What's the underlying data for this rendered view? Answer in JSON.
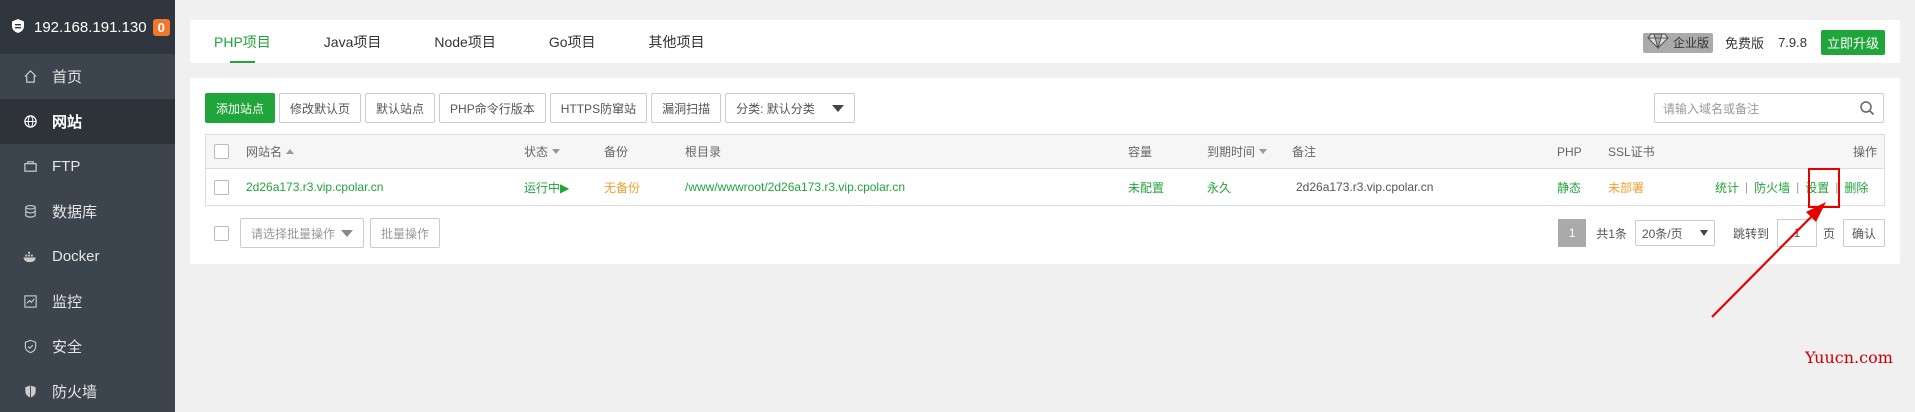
{
  "sidebar": {
    "ip": "192.168.191.130",
    "badge": "0",
    "items": [
      {
        "label": "首页",
        "icon": "home-icon"
      },
      {
        "label": "网站",
        "icon": "globe-icon",
        "active": true
      },
      {
        "label": "FTP",
        "icon": "ftp-icon"
      },
      {
        "label": "数据库",
        "icon": "database-icon"
      },
      {
        "label": "Docker",
        "icon": "docker-icon"
      },
      {
        "label": "监控",
        "icon": "monitor-icon"
      },
      {
        "label": "安全",
        "icon": "shield-icon"
      },
      {
        "label": "防火墙",
        "icon": "firewall-icon"
      }
    ]
  },
  "tabs": [
    "PHP项目",
    "Java项目",
    "Node项目",
    "Go项目",
    "其他项目"
  ],
  "header_right": {
    "enterprise": "企业版",
    "free": "免费版",
    "version": "7.9.8",
    "upgrade": "立即升级"
  },
  "toolbar": {
    "add_site": "添加站点",
    "edit_default_page": "修改默认页",
    "default_site": "默认站点",
    "php_cli": "PHP命令行版本",
    "https_guard": "HTTPS防窜站",
    "vuln_scan": "漏洞扫描",
    "category": "分类: 默认分类"
  },
  "search": {
    "placeholder": "请输入域名或备注"
  },
  "table": {
    "headers": {
      "name": "网站名",
      "status": "状态",
      "backup": "备份",
      "root": "根目录",
      "capacity": "容量",
      "expire": "到期时间",
      "note": "备注",
      "php": "PHP",
      "ssl": "SSL证书",
      "ops": "操作"
    },
    "row": {
      "name": "2d26a173.r3.vip.cpolar.cn",
      "status": "运行中▶",
      "backup": "无备份",
      "root": "/www/wwwroot/2d26a173.r3.vip.cpolar.cn",
      "capacity": "未配置",
      "expire": "永久",
      "note": "2d26a173.r3.vip.cpolar.cn",
      "php": "静态",
      "ssl": "未部署",
      "op_stats": "统计",
      "op_firewall": "防火墙",
      "op_settings": "设置",
      "op_delete": "删除"
    }
  },
  "batch": {
    "placeholder": "请选择批量操作",
    "button": "批量操作"
  },
  "pager": {
    "current": "1",
    "total": "共1条",
    "page_size": "20条/页",
    "jump_label": "跳转到",
    "jump_value": "1",
    "page_unit": "页",
    "confirm": "确认"
  },
  "watermark": "Yuucn.com",
  "colors": {
    "accent": "#20a53a",
    "warn": "#f0a030",
    "highlight": "#e60000"
  }
}
